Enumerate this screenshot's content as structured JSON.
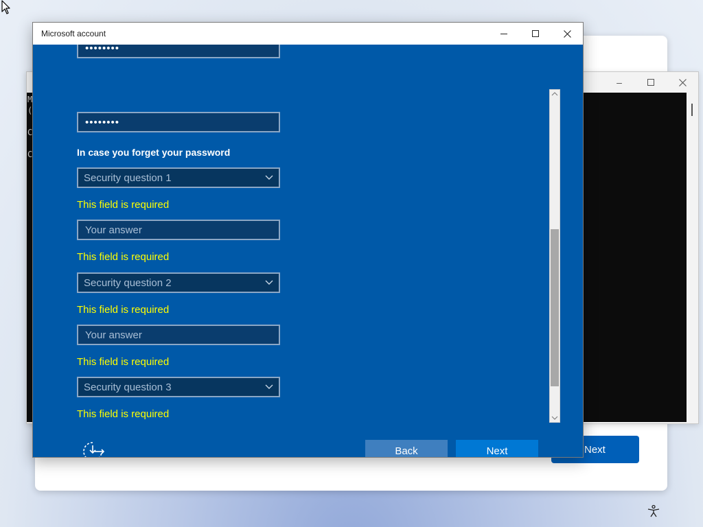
{
  "background": {
    "next_label": "Next",
    "console_lines": "M\n(\n\nC\n\nC"
  },
  "dialog": {
    "title": "Microsoft account",
    "controls": {
      "minimize": "minimize-icon",
      "maximize": "maximize-icon",
      "close": "close-icon"
    },
    "password_masked": "••••••••",
    "confirm_password_masked": "••••••••",
    "hint_title": "In case you forget your password",
    "security_questions": [
      {
        "question_placeholder": "Security question 1",
        "answer_placeholder": "Your answer",
        "question_error": "This field is required",
        "answer_error": "This field is required"
      },
      {
        "question_placeholder": "Security question 2",
        "answer_placeholder": "Your answer",
        "question_error": "This field is required",
        "answer_error": "This field is required"
      },
      {
        "question_placeholder": "Security question 3",
        "question_error": "This field is required"
      }
    ],
    "back_label": "Back",
    "next_label": "Next"
  },
  "colors": {
    "dialog_bg": "#0059a8",
    "error_text": "#ffff00",
    "next_button": "#0078d4",
    "back_button": "#3f7fbf"
  }
}
